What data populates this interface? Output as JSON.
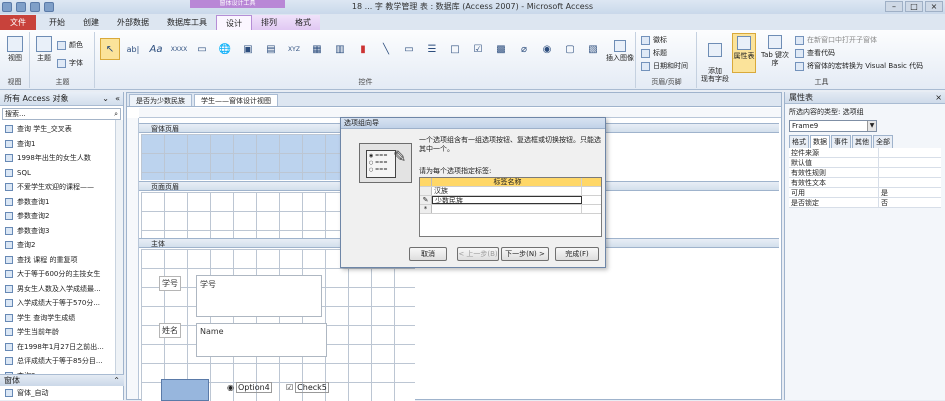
{
  "titlebar": {
    "window_title": "18 ... 字 教学管理 表 : 数据库 (Access 2007) - Microsoft Access",
    "tool_tab_label": "窗体设计工具"
  },
  "tabs": [
    "文件",
    "开始",
    "创建",
    "外部数据",
    "数据库工具",
    "设计",
    "排列",
    "格式"
  ],
  "ribbon": {
    "views_label": "视图",
    "view_button": "视图",
    "theme_button": "主题",
    "colors_label": "颜色",
    "font_label": "字体",
    "themes_group_label": "主题",
    "ab_label": "ab|",
    "aa_label": "Aa",
    "xxxx_label": "XXXX",
    "xyz_label": "XYZ",
    "controls_group_label": "控件",
    "insert_image_label": "插入图像",
    "logo_label": "徽标",
    "title_label": "标题",
    "datetime_label": "日期和时间",
    "header_footer_group_label": "页眉/页脚",
    "add_fields_label": "添加\n现有字段",
    "property_sheet_label": "属性表",
    "tab_order_label": "Tab 键次序",
    "new_window_label": "在新窗口中打开子窗体",
    "view_code_label": "查看代码",
    "convert_vba_label": "将窗体的宏转换为 Visual Basic 代码",
    "tools_group_label": "工具"
  },
  "nav": {
    "header": "所有 Access 对象",
    "search_placeholder": "搜索...",
    "items": [
      "查询 学生_交叉表",
      "查询1",
      "1998年出生的女生人数",
      "SQL",
      "不爱学生欢迎的课程——",
      "参数查询1",
      "参数查询2",
      "参数查询3",
      "查询2",
      "查找 课程 的重复项",
      "大于等于600分的主技女生",
      "男女生人数及入学成绩最...",
      "入学成绩大于等于570分...",
      "学生 查询学生成绩",
      "学生当前年龄",
      "在1998年1月27日之前出...",
      "总评成绩大于等于85分目...",
      "查询3"
    ],
    "group2": "窗体",
    "group2_item": "窗体_自动"
  },
  "doc": {
    "tabs": [
      "是否为少数民族",
      "学生——窗体设计视图"
    ],
    "form_header": "窗体页眉",
    "page_header": "页面页眉",
    "body": "主体",
    "label1": "学号",
    "field1": "学号",
    "label2": "姓名",
    "field2": "Name",
    "option": "Option4",
    "check": "Check5"
  },
  "wizard": {
    "title": "选项组向导",
    "desc": "一个选项组含有一组选项按钮、复选框或切换按钮。只能选其中一个。",
    "prompt": "请为每个选项指定标签:",
    "col_header": "标签名称",
    "rows": [
      "汉族",
      "少数民族",
      ""
    ],
    "cancel": "取消",
    "back": "< 上一步(B)",
    "next": "下一步(N) >",
    "finish": "完成(F)"
  },
  "propsheet": {
    "title": "属性表",
    "sel_type": "所选内容的类型: 选项组",
    "combo": "Frame9",
    "tabs": [
      "格式",
      "数据",
      "事件",
      "其他",
      "全部"
    ],
    "rows": [
      {
        "key": "控件来源",
        "val": ""
      },
      {
        "key": "默认值",
        "val": ""
      },
      {
        "key": "有效性规则",
        "val": ""
      },
      {
        "key": "有效性文本",
        "val": ""
      },
      {
        "key": "可用",
        "val": "是"
      },
      {
        "key": "是否锁定",
        "val": "否"
      }
    ]
  }
}
